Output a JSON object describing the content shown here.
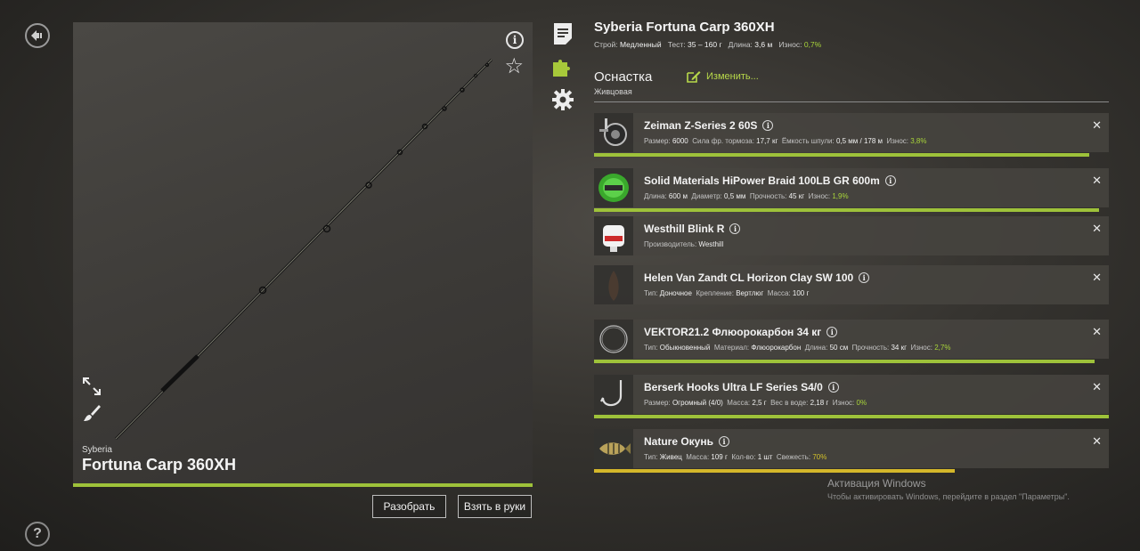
{
  "nav": {
    "back_icon": "back-arrow-icon",
    "help_label": "?"
  },
  "preview": {
    "brand": "Syberia",
    "name": "Fortuna Carp 360XH",
    "info_label": "i",
    "star_glyph": "☆",
    "condition": 1.0
  },
  "actions": {
    "disassemble": "Разобрать",
    "take": "Взять в руки"
  },
  "rod": {
    "title": "Syberia Fortuna Carp 360XH",
    "action_label": "Строй:",
    "action_value": "Медленный",
    "test_label": "Тест:",
    "test_value": "35 – 160 г",
    "length_label": "Длина:",
    "length_value": "3,6 м",
    "wear_label": "Износ:",
    "wear_value": "0,7%"
  },
  "rig": {
    "title": "Оснастка",
    "subtitle": "Живцовая",
    "change_label": "Изменить..."
  },
  "items": [
    {
      "name": "Zeiman Z-Series 2 60S",
      "meta": [
        {
          "label": "Размер:",
          "value": "6000"
        },
        {
          "label": "Сила фр. тормоза:",
          "value": "17,7 кг"
        },
        {
          "label": "Ёмкость шпули:",
          "value": "0,5 мм / 178 м"
        },
        {
          "label": "Износ:",
          "value": "3,8%",
          "tone": "g"
        }
      ],
      "condition": 0.962,
      "bar_color": "green"
    },
    {
      "name": "Solid Materials HiPower Braid 100LB GR 600m",
      "meta": [
        {
          "label": "Длина:",
          "value": "600 м"
        },
        {
          "label": "Диаметр:",
          "value": "0,5 мм"
        },
        {
          "label": "Прочность:",
          "value": "45 кг"
        },
        {
          "label": "Износ:",
          "value": "1,9%",
          "tone": "g"
        }
      ],
      "condition": 0.981,
      "bar_color": "green"
    },
    {
      "name": "Westhill Blink R",
      "meta": [
        {
          "label": "Производитель:",
          "value": "Westhill"
        }
      ],
      "condition": null
    },
    {
      "name": "Helen Van Zandt CL Horizon Clay SW 100",
      "meta": [
        {
          "label": "Тип:",
          "value": "Доночное"
        },
        {
          "label": "Крепление:",
          "value": "Вертлюг"
        },
        {
          "label": "Масса:",
          "value": "100 г"
        }
      ],
      "condition": null
    },
    {
      "name": "VEKTOR21.2 Флюорокарбон 34 кг",
      "meta": [
        {
          "label": "Тип:",
          "value": "Обыкновенный"
        },
        {
          "label": "Материал:",
          "value": "Флюорокарбон"
        },
        {
          "label": "Длина:",
          "value": "50 см"
        },
        {
          "label": "Прочность:",
          "value": "34 кг"
        },
        {
          "label": "Износ:",
          "value": "2,7%",
          "tone": "g"
        }
      ],
      "condition": 0.973,
      "bar_color": "green"
    },
    {
      "name": "Berserk Hooks Ultra LF Series S4/0",
      "meta": [
        {
          "label": "Размер:",
          "value": "Огромный (4/0)"
        },
        {
          "label": "Масса:",
          "value": "2,5 г"
        },
        {
          "label": "Вес в воде:",
          "value": "2,18 г"
        },
        {
          "label": "Износ:",
          "value": "0%",
          "tone": "g"
        }
      ],
      "condition": 1.0,
      "bar_color": "green"
    },
    {
      "name": "Nature Окунь",
      "meta": [
        {
          "label": "Тип:",
          "value": "Живец"
        },
        {
          "label": "Масса:",
          "value": "109 г"
        },
        {
          "label": "Кол-во:",
          "value": "1 шт"
        },
        {
          "label": "Свежесть:",
          "value": "70%",
          "tone": "y"
        }
      ],
      "condition": 0.7,
      "bar_color": "yellow"
    }
  ],
  "item_icons": [
    "reel-icon",
    "braid-spool-icon",
    "bite-alarm-icon",
    "sinker-icon",
    "fluorocarbon-leader-icon",
    "hook-icon",
    "perch-bait-icon"
  ],
  "watermark": {
    "title": "Активация Windows",
    "subtitle": "Чтобы активировать Windows, перейдите в раздел \"Параметры\"."
  },
  "colors": {
    "accent_green": "#9ec23a",
    "accent_yellow": "#d4b72a",
    "value_green": "#a8d43a"
  }
}
